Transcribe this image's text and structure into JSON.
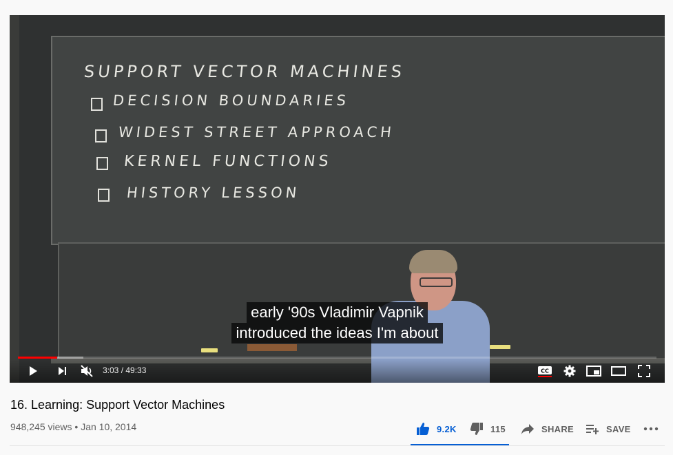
{
  "video": {
    "board_title": "SUPPORT VECTOR MACHINES",
    "board_items": [
      "DECISION BOUNDARIES",
      "WIDEST STREET APPROACH",
      "KERNEL FUNCTIONS",
      "HISTORY LESSON"
    ],
    "captions": [
      "early '90s Vladimir Vapnik",
      "introduced the ideas I'm about"
    ],
    "progress": {
      "played_fraction": 0.061,
      "buffered_fraction": 0.102
    }
  },
  "controls": {
    "time_display": "3:03 / 49:33",
    "icons": [
      "play-icon",
      "next-icon",
      "volume-muted-icon",
      "cc-icon",
      "settings-icon",
      "miniplayer-icon",
      "theater-icon",
      "fullscreen-icon"
    ]
  },
  "info": {
    "title": "16. Learning: Support Vector Machines",
    "views": "948,245 views",
    "separator": "•",
    "date": "Jan 10, 2014"
  },
  "actions": {
    "like_count": "9.2K",
    "dislike_count": "115",
    "share_label": "SHARE",
    "save_label": "SAVE"
  },
  "colors": {
    "accent_blue": "#065fd4",
    "progress_red": "#ff0000"
  }
}
